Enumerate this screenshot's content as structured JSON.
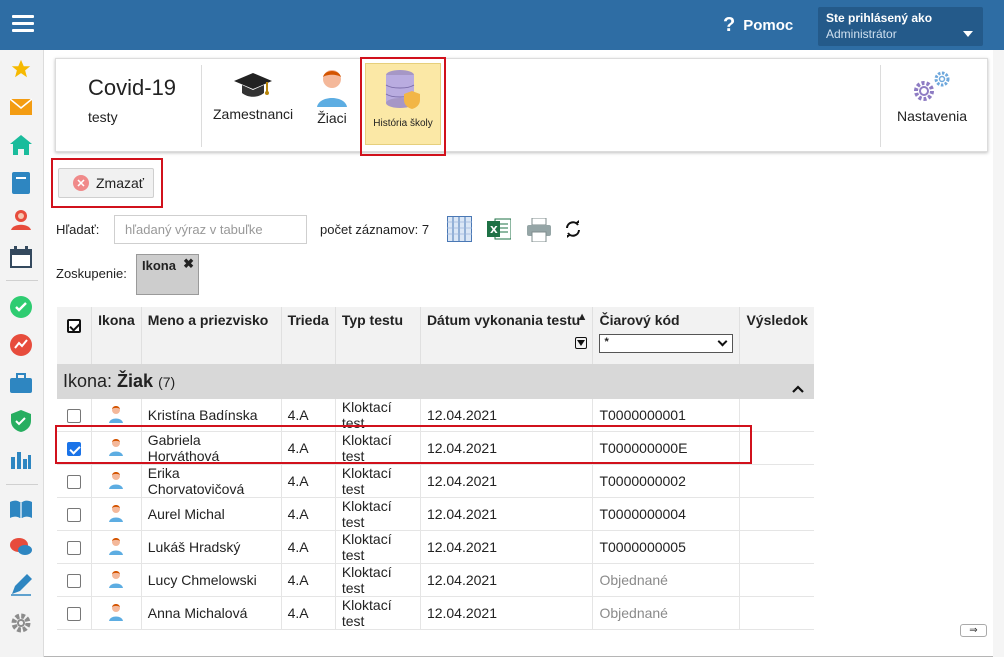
{
  "header": {
    "help_label": "Pomoc",
    "help_icon": "?",
    "user_title": "Ste prihlásený ako",
    "user_name": "Administrátor"
  },
  "ribbon": {
    "title": "Covid-19",
    "subtitle": "testy",
    "buttons": [
      {
        "label": "Zamestnanci",
        "icon": "graduation-cap-icon"
      },
      {
        "label": "Žiaci",
        "icon": "student-icon"
      },
      {
        "label": "História školy",
        "icon": "database-shield-icon"
      },
      {
        "label": "Nastavenia",
        "icon": "gears-icon"
      }
    ]
  },
  "toolbar": {
    "delete_label": "Zmazať",
    "search_label": "Hľadať:",
    "search_placeholder": "hľadaný výraz v tabuľke",
    "count_label": "počet záznamov: 7",
    "grouping_label": "Zoskupenie:",
    "grouping_chip": "Ikona",
    "chip_close": "✖"
  },
  "table": {
    "columns": [
      "Ikona",
      "Meno a priezvisko",
      "Trieda",
      "Typ testu",
      "Dátum vykonania testu",
      "Čiarový kód",
      "Výsledok"
    ],
    "barcode_filter": "*",
    "sort_indicator": "▲",
    "group": {
      "prefix": "Ikona: ",
      "name": "Žiak",
      "count": "(7)"
    },
    "rows": [
      {
        "checked": false,
        "name": "Kristína Badínska",
        "class": "4.A",
        "test": "Kloktací test",
        "date": "12.04.2021",
        "code": "T0000000001",
        "result": ""
      },
      {
        "checked": true,
        "name": "Gabriela Horváthová",
        "class": "4.A",
        "test": "Kloktací test",
        "date": "12.04.2021",
        "code": "T000000000E",
        "result": ""
      },
      {
        "checked": false,
        "name": "Erika Chorvatovičová",
        "class": "4.A",
        "test": "Kloktací test",
        "date": "12.04.2021",
        "code": "T0000000002",
        "result": ""
      },
      {
        "checked": false,
        "name": "Aurel Michal",
        "class": "4.A",
        "test": "Kloktací test",
        "date": "12.04.2021",
        "code": "T0000000004",
        "result": ""
      },
      {
        "checked": false,
        "name": "Lukáš Hradský",
        "class": "4.A",
        "test": "Kloktací test",
        "date": "12.04.2021",
        "code": "T0000000005",
        "result": ""
      },
      {
        "checked": false,
        "name": "Lucy Chmelowski",
        "class": "4.A",
        "test": "Kloktací test",
        "date": "12.04.2021",
        "code": "Objednané",
        "result": ""
      },
      {
        "checked": false,
        "name": "Anna Michalová",
        "class": "4.A",
        "test": "Kloktací test",
        "date": "12.04.2021",
        "code": "Objednané",
        "result": ""
      }
    ]
  },
  "footer": {
    "scroll_arrow": "⇒"
  },
  "colors": {
    "topbar": "#2e6da4",
    "active_tab": "#fbe8a6",
    "highlight": "#d1111c",
    "checkbox": "#1a73e8"
  }
}
